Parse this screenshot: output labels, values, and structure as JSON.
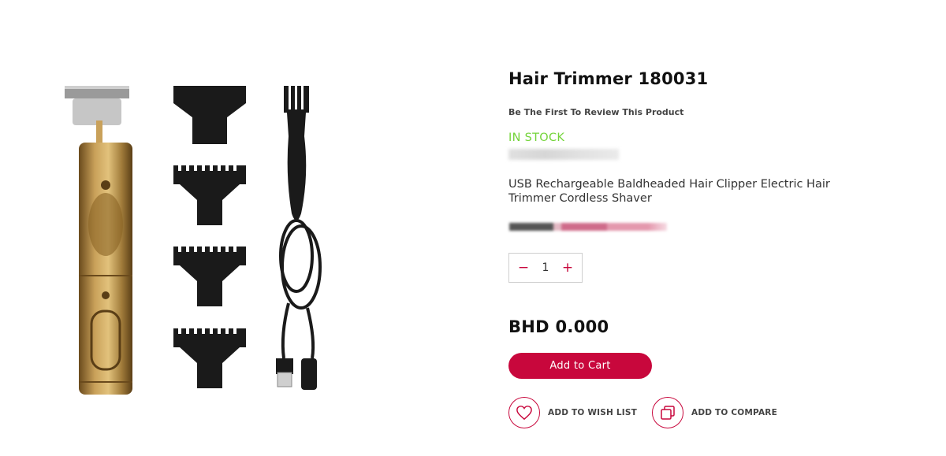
{
  "product": {
    "title": "Hair Trimmer 180031",
    "review_link": "Be The First To Review This Product",
    "stock_status": "IN STOCK",
    "description": "USB Rechargeable Baldheaded Hair Clipper Electric Hair Trimmer Cordless Shaver",
    "price": "BHD 0.000"
  },
  "quantity": {
    "decrement": "−",
    "value": "1",
    "increment": "+"
  },
  "actions": {
    "add_to_cart": "Add to Cart",
    "wishlist": "ADD TO WISH LIST",
    "compare": "ADD TO COMPARE"
  },
  "icons": {
    "wishlist": "heart-icon",
    "compare": "compare-icon"
  },
  "colors": {
    "accent": "#c8073c",
    "in_stock": "#74d43a"
  }
}
